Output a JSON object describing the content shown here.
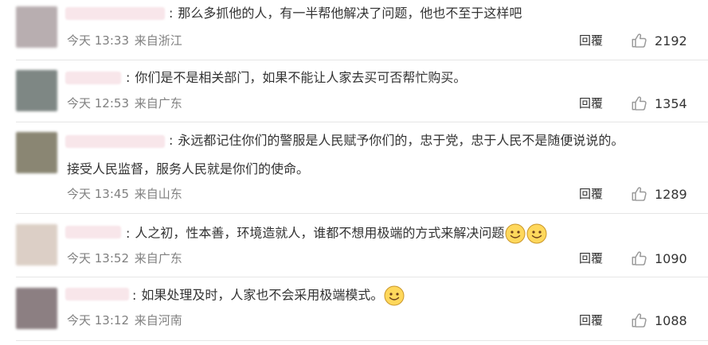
{
  "comments": [
    {
      "text": "那么多抓他的人，有一半帮他解决了问题，他也不至于这样吧",
      "time": "今天 13:33",
      "location": "来自浙江",
      "reply_label": "回覆",
      "likes": "2192",
      "avatar_color": "#b8aeb0"
    },
    {
      "text": "你们是不是相关部门，如果不能让人家去买可否帮忙购买。",
      "time": "今天 12:53",
      "location": "来自广东",
      "reply_label": "回覆",
      "likes": "1354",
      "avatar_color": "#7e8784"
    },
    {
      "text": "永远都记住你们的警服是人民赋予你们的，忠于党，忠于人民不是随便说说的。",
      "text2": "接受人民监督，服务人民就是你们的使命。",
      "time": "今天 13:45",
      "location": "来自山东",
      "reply_label": "回覆",
      "likes": "1289",
      "avatar_color": "#8a8673"
    },
    {
      "text": "人之初，性本善，环境造就人，谁都不想用极端的方式来解决问题",
      "time": "今天 13:52",
      "location": "来自广东",
      "reply_label": "回覆",
      "likes": "1090",
      "avatar_color": "#dccfc6"
    },
    {
      "text": "如果处理及时，人家也不会采用极端模式。",
      "time": "今天 13:12",
      "location": "来自河南",
      "reply_label": "回覆",
      "likes": "1088",
      "avatar_color": "#8c7f82"
    }
  ],
  "colors": {
    "accent_text": "#333333",
    "meta_text": "#808080",
    "username_blur": "#f8e6ea"
  },
  "icons": {
    "like": "thumbs-up-icon",
    "emoji": "smile-emoji-icon"
  }
}
